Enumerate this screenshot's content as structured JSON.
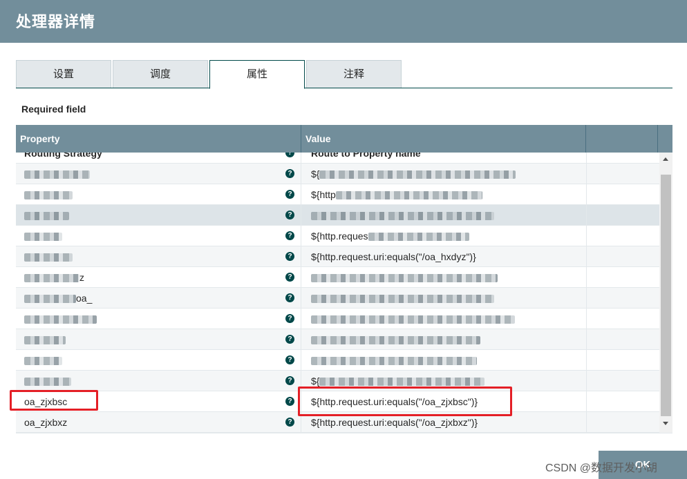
{
  "dialog": {
    "title": "处理器详情"
  },
  "tabs": [
    {
      "label": "设置",
      "active": false
    },
    {
      "label": "调度",
      "active": false
    },
    {
      "label": "属性",
      "active": true
    },
    {
      "label": "注释",
      "active": false
    }
  ],
  "required_label": "Required field",
  "table": {
    "headers": {
      "property": "Property",
      "value": "Value"
    },
    "rows": [
      {
        "name": "Routing Strategy",
        "value": "Route to Property name",
        "blurred": false,
        "bold": true
      },
      {
        "name": "",
        "value": "${",
        "blurred": true
      },
      {
        "name": "",
        "value": "${http",
        "blurred": true
      },
      {
        "name": "",
        "value": "",
        "blurred": true,
        "selected": true
      },
      {
        "name": "",
        "value": "${http.reques",
        "blurred": true
      },
      {
        "name": "",
        "value": "${http.request.uri:equals(\"/oa_hxdyz\")}",
        "blurred": true
      },
      {
        "name": "z",
        "value": "",
        "blurred": true
      },
      {
        "name": "oa_",
        "value": "",
        "blurred": true
      },
      {
        "name": "",
        "value": "",
        "blurred": true
      },
      {
        "name": "",
        "value": "",
        "blurred": true
      },
      {
        "name": "",
        "value": "",
        "blurred": true
      },
      {
        "name": "",
        "value": "${",
        "blurred": true
      },
      {
        "name": "oa_zjxbsc",
        "value": "${http.request.uri:equals(\"/oa_zjxbsc\")}",
        "blurred": false
      },
      {
        "name": "oa_zjxbxz",
        "value": "${http.request.uri:equals(\"/oa_zjxbxz\")}",
        "blurred": false
      }
    ]
  },
  "ok_button": {
    "label": "OK"
  },
  "watermark": "CSDN @数据开发小胡",
  "colors": {
    "header": "#728e9b",
    "accent": "#004849",
    "highlight": "#e41f26"
  },
  "icons": {
    "help": "question-circle-icon"
  }
}
